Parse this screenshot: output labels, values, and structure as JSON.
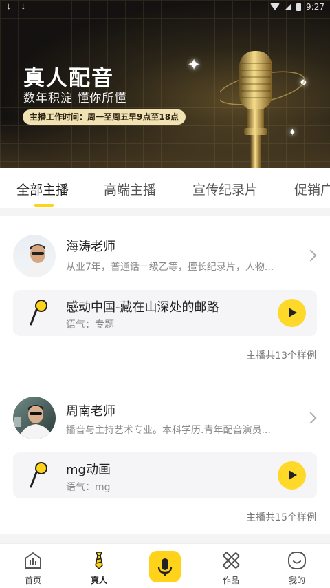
{
  "status_bar": {
    "time": "9:27"
  },
  "banner": {
    "title": "真人配音",
    "subtitle": "数年积淀 懂你所懂",
    "hours": "主播工作时间：周一至周五早9点至18点"
  },
  "tabs": [
    {
      "label": "全部主播",
      "active": true
    },
    {
      "label": "高端主播",
      "active": false
    },
    {
      "label": "宣传纪录片",
      "active": false
    },
    {
      "label": "促销广",
      "active": false
    }
  ],
  "hosts": [
    {
      "name": "海涛老师",
      "desc": "从业7年，普通话一级乙等，擅长纪录片，人物...",
      "sample_title": "感动中国-藏在山深处的邮路",
      "sample_tone": "语气：专题",
      "count": "主播共13个样例"
    },
    {
      "name": "周南老师",
      "desc": "播音与主持艺术专业。本科学历.青年配音演员...",
      "sample_title": "mg动画",
      "sample_tone": "语气：mg",
      "count": "主播共15个样例"
    }
  ],
  "nav": [
    {
      "label": "首页",
      "icon": "home-chart-icon"
    },
    {
      "label": "真人",
      "icon": "tie-icon",
      "active": true
    },
    {
      "label": "",
      "icon": "microphone-icon"
    },
    {
      "label": "作品",
      "icon": "pencil-ruler-icon"
    },
    {
      "label": "我的",
      "icon": "smiley-face-icon"
    }
  ],
  "colors": {
    "accent": "#ffd31a",
    "banner_pill": "#f1e2b4"
  }
}
